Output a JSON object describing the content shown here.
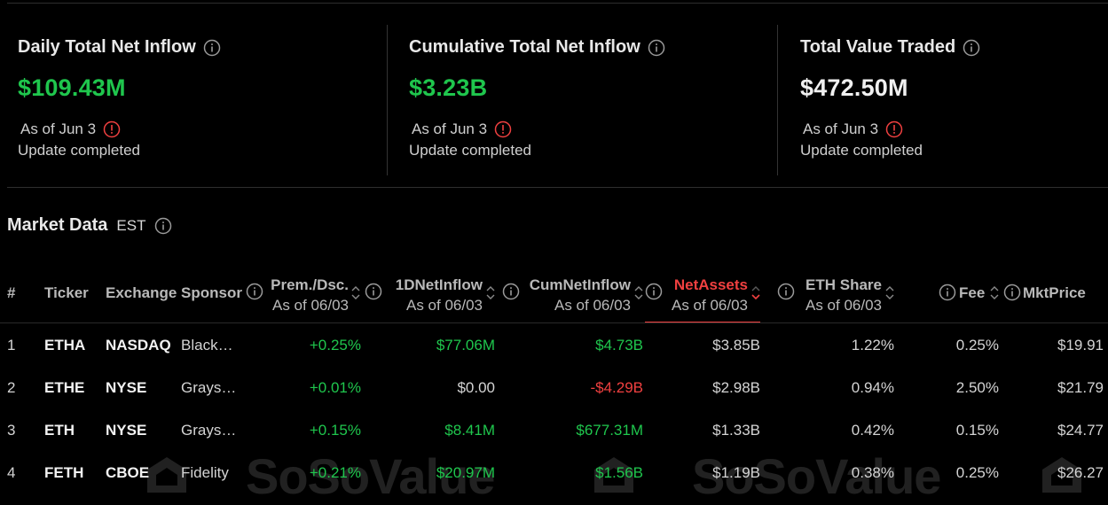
{
  "stats": [
    {
      "title": "Daily Total Net Inflow",
      "value": "$109.43M",
      "as_of": "As of Jun 3",
      "status": "Update completed"
    },
    {
      "title": "Cumulative Total Net Inflow",
      "value": "$3.23B",
      "as_of": "As of Jun 3",
      "status": "Update completed"
    },
    {
      "title": "Total Value Traded",
      "value": "$472.50M",
      "as_of": "As of Jun 3",
      "status": "Update completed"
    }
  ],
  "market": {
    "title": "Market Data",
    "timezone": "EST"
  },
  "columns": {
    "num": "#",
    "ticker": "Ticker",
    "exchange": "Exchange",
    "sponsor": "Sponsor",
    "prem": "Prem./Dsc.",
    "prem_sub": "As of 06/03",
    "inflow": "1DNetInflow",
    "inflow_sub": "As of 06/03",
    "cum": "CumNetInflow",
    "cum_sub": "As of 06/03",
    "net": "NetAssets",
    "net_sub": "As of 06/03",
    "share": "ETH Share",
    "share_sub": "As of 06/03",
    "fee": "Fee",
    "price": "MktPrice"
  },
  "rows": [
    {
      "num": "1",
      "ticker": "ETHA",
      "exchange": "NASDAQ",
      "sponsor": "Black…",
      "prem": "+0.25%",
      "inflow": "$77.06M",
      "cum": "$4.73B",
      "net": "$3.85B",
      "share": "1.22%",
      "fee": "0.25%",
      "price": "$19.91"
    },
    {
      "num": "2",
      "ticker": "ETHE",
      "exchange": "NYSE",
      "sponsor": "Grays…",
      "prem": "+0.01%",
      "inflow": "$0.00",
      "cum": "-$4.29B",
      "net": "$2.98B",
      "share": "0.94%",
      "fee": "2.50%",
      "price": "$21.79"
    },
    {
      "num": "3",
      "ticker": "ETH",
      "exchange": "NYSE",
      "sponsor": "Grays…",
      "prem": "+0.15%",
      "inflow": "$8.41M",
      "cum": "$677.31M",
      "net": "$1.33B",
      "share": "0.42%",
      "fee": "0.15%",
      "price": "$24.77"
    },
    {
      "num": "4",
      "ticker": "FETH",
      "exchange": "CBOE",
      "sponsor": "Fidelity",
      "prem": "+0.21%",
      "inflow": "$20.97M",
      "cum": "$1.56B",
      "net": "$1.19B",
      "share": "0.38%",
      "fee": "0.25%",
      "price": "$26.27"
    }
  ],
  "watermark": "SoSoValue",
  "colors": {
    "positive": "#1fc64d",
    "negative": "#f04040",
    "active_sort": "#f04040"
  }
}
